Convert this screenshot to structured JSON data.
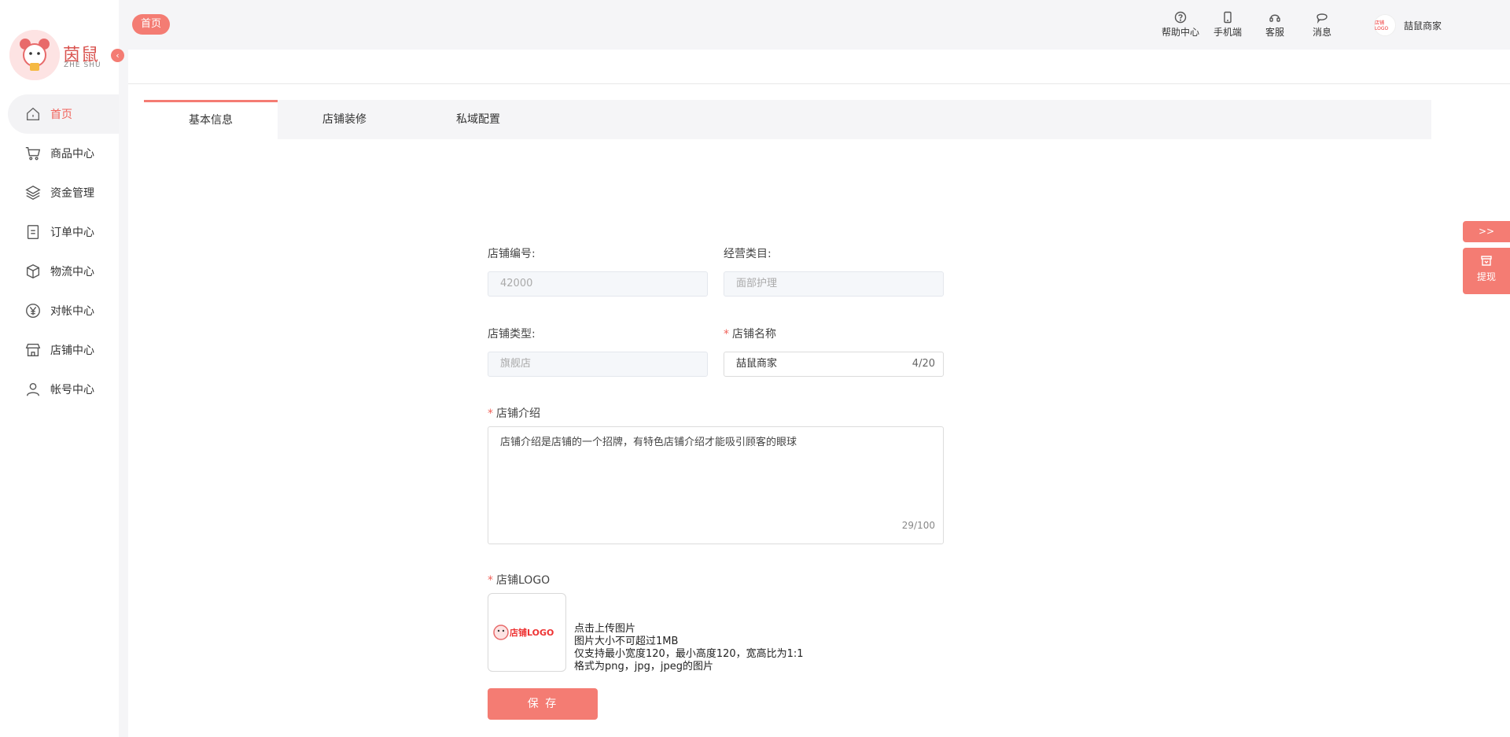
{
  "brand": {
    "logo_text": "茵鼠",
    "logo_sub": "ZHE SHU"
  },
  "sidebar": {
    "items": [
      {
        "label": "首页",
        "icon": "home-icon",
        "active": true
      },
      {
        "label": "商品中心",
        "icon": "cart-icon"
      },
      {
        "label": "资金管理",
        "icon": "layers-icon"
      },
      {
        "label": "订单中心",
        "icon": "order-icon"
      },
      {
        "label": "物流中心",
        "icon": "box-icon"
      },
      {
        "label": "对帐中心",
        "icon": "yen-icon"
      },
      {
        "label": "店铺中心",
        "icon": "store-icon"
      },
      {
        "label": "帐号中心",
        "icon": "user-icon"
      }
    ]
  },
  "topbar": {
    "home_tag": "首页",
    "tools": [
      {
        "label": "帮助中心",
        "icon": "help-icon"
      },
      {
        "label": "手机端",
        "icon": "phone-icon"
      },
      {
        "label": "客服",
        "icon": "headset-icon"
      },
      {
        "label": "消息",
        "icon": "message-icon"
      }
    ],
    "user_name": "喆鼠商家",
    "avatar_text": "店铺LOGO"
  },
  "tabs": [
    {
      "label": "基本信息",
      "active": true
    },
    {
      "label": "店铺装修"
    },
    {
      "label": "私域配置"
    }
  ],
  "form": {
    "shop_no_label": "店铺编号:",
    "shop_no_value": "42000",
    "category_label": "经营类目:",
    "category_value": "面部护理",
    "shop_type_label": "店铺类型:",
    "shop_type_value": "旗舰店",
    "shop_name_label": "店铺名称",
    "shop_name_value": "喆鼠商家",
    "shop_name_count": "4/20",
    "intro_label": "店铺介绍",
    "intro_value": "店铺介绍是店铺的一个招牌，有特色店铺介绍才能吸引顾客的眼球",
    "intro_count": "29/100",
    "logo_label": "店铺LOGO",
    "logo_image_text": "店铺LOGO",
    "upload_hint": [
      "点击上传图片",
      "图片大小不可超过1MB",
      "仅支持最小宽度120，最小高度120，宽高比为1:1",
      "格式为png，jpg，jpeg的图片"
    ],
    "save_label": "保 存"
  },
  "floating": {
    "toggle_label": ">>",
    "withdraw_label": "提现"
  },
  "colors": {
    "accent": "#f47c73",
    "active_text": "#f0625a"
  }
}
